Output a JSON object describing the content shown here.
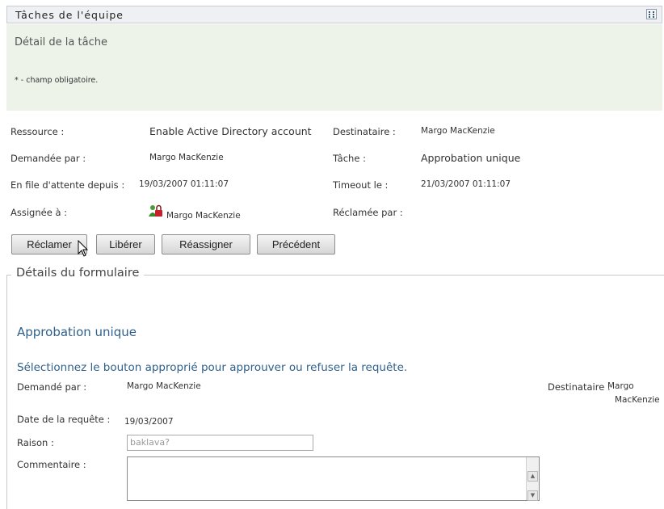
{
  "header": {
    "title": "Tâches de l'équipe",
    "grid_icon": "grid-icon"
  },
  "banner": {
    "subtitle": "Détail de la tâche",
    "required_note": "* - champ obligatoire."
  },
  "task": {
    "resource_label": "Ressource :",
    "resource_value": "Enable Active Directory account",
    "recipient_label": "Destinataire :",
    "recipient_value": "Margo MacKenzie",
    "requested_by_label": "Demandée par :",
    "requested_by_value": "Margo MacKenzie",
    "task_label": "Tâche :",
    "task_value": "Approbation unique",
    "queued_label": "En file d'attente depuis :",
    "queued_value": "19/03/2007 01:11:07",
    "timeout_label": "Timeout le :",
    "timeout_value": "21/03/2007 01:11:07",
    "assigned_label": "Assignée à :",
    "assigned_value": "Margo MacKenzie",
    "assigned_icon": "user-lock-icon",
    "claimed_label": "Réclamée par :"
  },
  "buttons": {
    "claim": "Réclamer",
    "release": "Libérer",
    "reassign": "Réassigner",
    "previous": "Précédent"
  },
  "form": {
    "legend": "Détails du formulaire",
    "heading": "Approbation unique",
    "description": "Sélectionnez le bouton approprié pour approuver ou refuser la requête.",
    "requested_by_label": "Demandé par :",
    "requested_by_value": "Margo MacKenzie",
    "recipient_label": "Destinataire :",
    "recipient_value_line1": "Margo",
    "recipient_value_line2": "MacKenzie",
    "date_label": "Date de la requête :",
    "date_value": "19/03/2007",
    "reason_label": "Raison :",
    "reason_value": "baklava?",
    "comment_label": "Commentaire :",
    "comment_value": ""
  },
  "colors": {
    "banner_bg": "#eef3ea",
    "heading_blue": "#2f5f8a",
    "titlebar_bg": "#eef0f3"
  }
}
